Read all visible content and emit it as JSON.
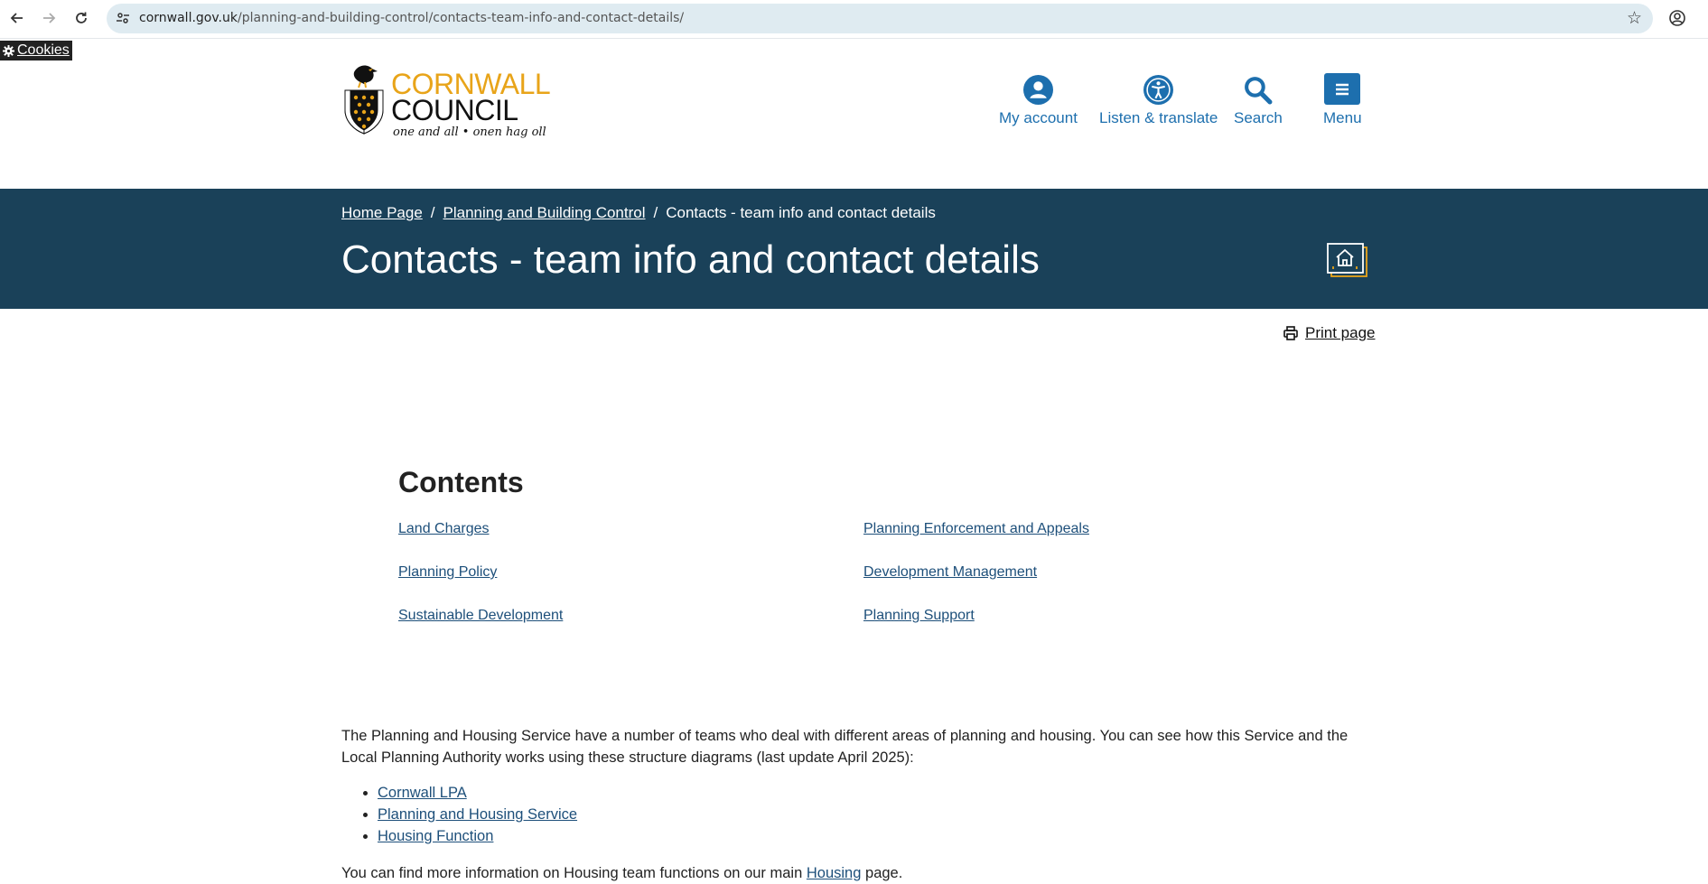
{
  "browser": {
    "url_domain": "cornwall.gov.uk",
    "url_path": "/planning-and-building-control/contacts-team-info-and-contact-details/",
    "back_icon": "arrow-left-icon",
    "forward_icon": "arrow-right-icon",
    "reload_icon": "reload-icon",
    "bookmark_icon": "star-icon",
    "profile_icon": "profile-icon"
  },
  "cookies": {
    "label": "Cookies",
    "icon": "gear-icon"
  },
  "logo": {
    "line1": "CORNWALL",
    "line2": "COUNCIL",
    "motto": "one and all • onen hag oll"
  },
  "header_nav": [
    {
      "label": "My account",
      "icon": "user-circle-icon"
    },
    {
      "label": "Listen & translate",
      "icon": "accessibility-icon"
    },
    {
      "label": "Search",
      "icon": "search-icon"
    },
    {
      "label": "Menu",
      "icon": "hamburger-icon"
    }
  ],
  "breadcrumb": {
    "items": [
      "Home Page",
      "Planning and Building Control"
    ],
    "current": "Contacts - team info and contact details",
    "separator": "/"
  },
  "page_title": "Contacts - team info and contact details",
  "print": {
    "label": "Print page",
    "icon": "printer-icon"
  },
  "contents": {
    "heading": "Contents",
    "links": [
      "Land Charges",
      "Planning Enforcement and Appeals",
      "Planning Policy",
      "Development Management",
      "Sustainable Development",
      "Planning Support"
    ]
  },
  "intro": {
    "paragraph": "The Planning and Housing Service have a number of teams who deal with different areas of planning and housing.  You can see how this Service and the Local Planning Authority works using these structure diagrams (last update April 2025):",
    "links": [
      "Cornwall LPA",
      "Planning and Housing Service",
      "Housing Function"
    ],
    "more_prefix": "You can find more information on Housing team functions on our main",
    "more_link": "Housing",
    "more_suffix": "page."
  },
  "colors": {
    "banner": "#1a4159",
    "brand_blue": "#1d6fae",
    "brand_gold": "#e8a419",
    "link": "#1d4f7a"
  }
}
